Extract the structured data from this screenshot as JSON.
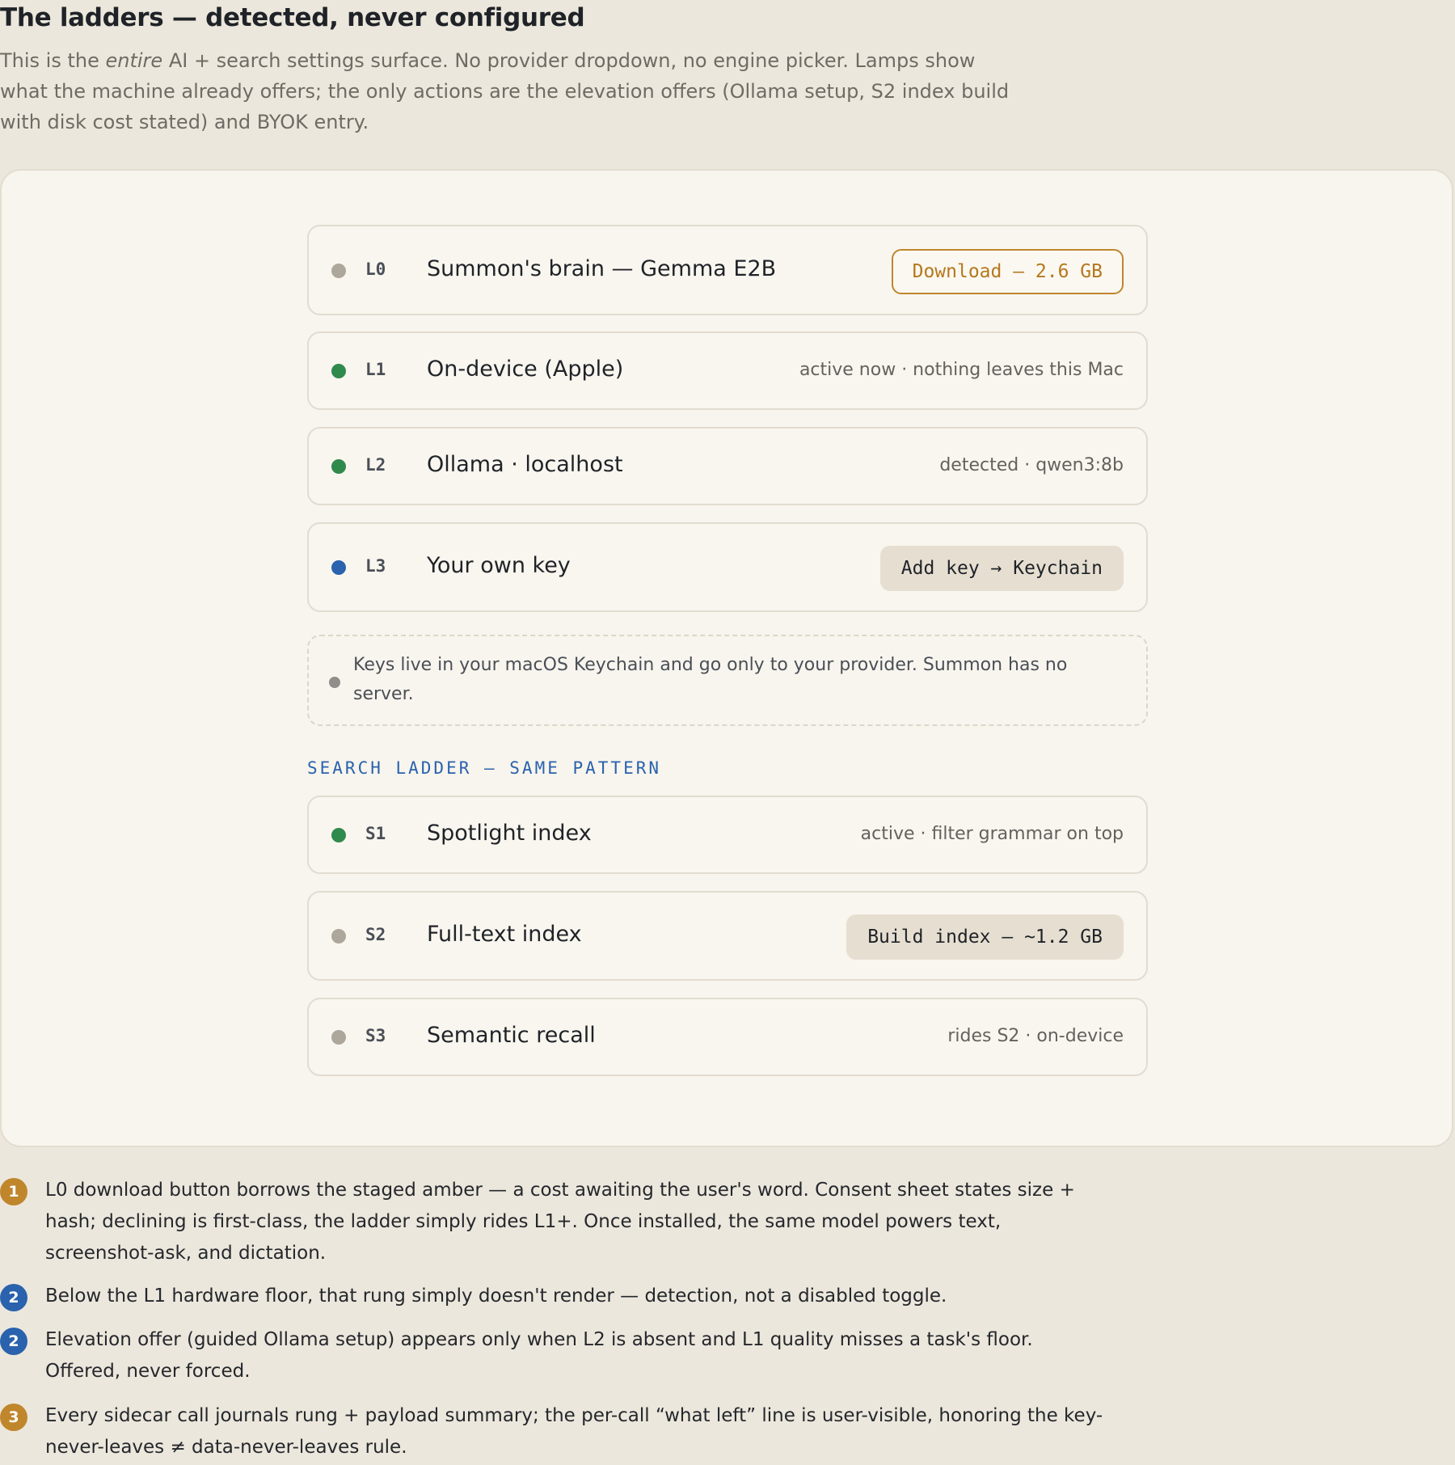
{
  "header": {
    "title": "The ladders — detected, never configured",
    "intro_before": "This is the ",
    "intro_em": "entire",
    "intro_after": " AI + search settings surface. No provider dropdown, no engine picker. Lamps show what the machine already offers; the only actions are the elevation offers (Ollama setup, S2 index build with disk cost stated) and BYOK entry."
  },
  "colors": {
    "page_bg": "#ece7dc",
    "panel_bg": "#f8f5ee",
    "lamp_grey": "#ada79b",
    "lamp_green": "#2f8a4b",
    "lamp_blue": "#2a62ad",
    "amber": "#c0862c",
    "accent_blue": "#2a62ad"
  },
  "ai_ladder": [
    {
      "code": "L0",
      "name": "Summon's brain — Gemma E2B",
      "lamp": "grey",
      "action": "Download — 2.6 GB"
    },
    {
      "code": "L1",
      "name": "On-device (Apple)",
      "lamp": "green",
      "status": "active now · nothing leaves this Mac"
    },
    {
      "code": "L2",
      "name": "Ollama · localhost",
      "lamp": "green",
      "status": "detected · qwen3:8b"
    },
    {
      "code": "L3",
      "name": "Your own key",
      "lamp": "blue",
      "action": "Add key → Keychain"
    }
  ],
  "keychain_note": "Keys live in your macOS Keychain and go only to your provider. Summon has no server.",
  "search_ladder": {
    "label": "SEARCH LADDER — SAME PATTERN",
    "rungs": [
      {
        "code": "S1",
        "name": "Spotlight index",
        "lamp": "green",
        "status": "active · filter grammar on top"
      },
      {
        "code": "S2",
        "name": "Full-text index",
        "lamp": "grey",
        "action": "Build index — ~1.2 GB"
      },
      {
        "code": "S3",
        "name": "Semantic recall",
        "lamp": "grey",
        "status": "rides S2 · on-device"
      }
    ]
  },
  "footnotes": [
    {
      "number": "1",
      "color": "amber",
      "text": "L0 download button borrows the staged amber — a cost awaiting the user's word. Consent sheet states size + hash; declining is first-class, the ladder simply rides L1+. Once installed, the same model powers text, screenshot-ask, and dictation."
    },
    {
      "number": "2",
      "color": "blue",
      "text": "Below the L1 hardware floor, that rung simply doesn't render — detection, not a disabled toggle."
    },
    {
      "number": "2",
      "color": "blue",
      "text": "Elevation offer (guided Ollama setup) appears only when L2 is absent and L1 quality misses a task's floor. Offered, never forced."
    },
    {
      "number": "3",
      "color": "amber",
      "text": "Every sidecar call journals rung + payload summary; the per-call “what left” line is user-visible, honoring the key-never-leaves ≠ data-never-leaves rule."
    }
  ]
}
